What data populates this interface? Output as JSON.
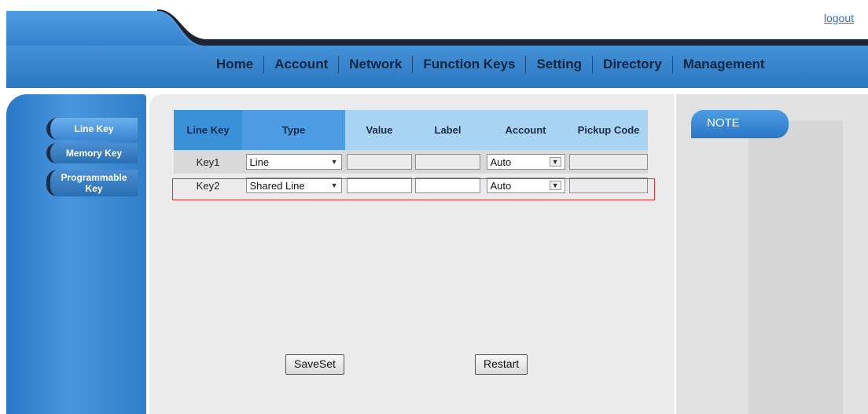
{
  "header": {
    "logout_label": "logout",
    "nav": [
      {
        "label": "Home"
      },
      {
        "label": "Account"
      },
      {
        "label": "Network"
      },
      {
        "label": "Function Keys",
        "active": true
      },
      {
        "label": "Setting"
      },
      {
        "label": "Directory"
      },
      {
        "label": "Management"
      }
    ]
  },
  "sidebar": {
    "items": [
      {
        "label": "Line Key",
        "active": true
      },
      {
        "label": "Memory Key"
      },
      {
        "label": "Programmable",
        "label2": "Key"
      }
    ]
  },
  "table": {
    "headers": [
      "Line Key",
      "Type",
      "Value",
      "Label",
      "Account",
      "Pickup Code"
    ],
    "rows": [
      {
        "key": "Key1",
        "type": "Line",
        "value": "",
        "label": "",
        "account": "Auto",
        "pickup_code": ""
      },
      {
        "key": "Key2",
        "type": "Shared Line",
        "value": "",
        "label": "",
        "account": "Auto",
        "pickup_code": ""
      }
    ]
  },
  "buttons": {
    "saveset": "SaveSet",
    "restart": "Restart"
  },
  "note": {
    "title": "NOTE"
  },
  "colors": {
    "header_band": "#3f8ed6",
    "header_dark": "#1e2530",
    "sidebar_blue": "#2a78c6",
    "highlight_border": "#dd3333"
  }
}
